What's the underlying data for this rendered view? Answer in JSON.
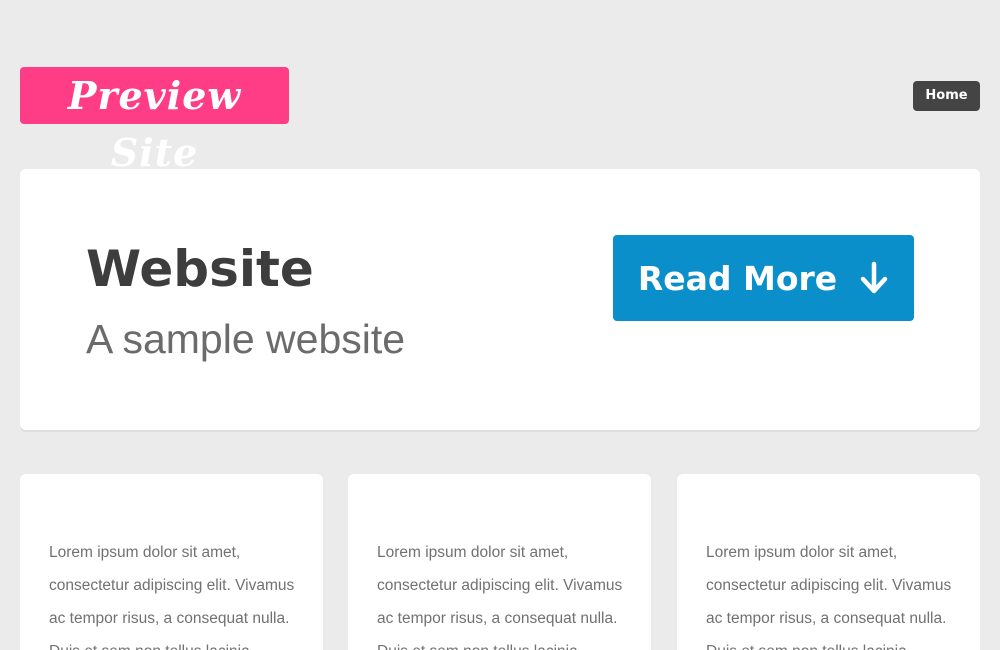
{
  "header": {
    "logo_text": "Preview Site",
    "nav": [
      {
        "label": "Home"
      }
    ]
  },
  "hero": {
    "title": "Website",
    "subtitle": "A sample website",
    "cta_label": "Read More",
    "cta_icon": "arrow-down-icon"
  },
  "cards": [
    {
      "text": "Lorem ipsum dolor sit amet, consectetur adipiscing elit. Vivamus ac tempor risus, a consequat nulla. Duis et sem non tellus lacinia"
    },
    {
      "text": "Lorem ipsum dolor sit amet, consectetur adipiscing elit. Vivamus ac tempor risus, a consequat nulla. Duis et sem non tellus lacinia"
    },
    {
      "text": "Lorem ipsum dolor sit amet, consectetur adipiscing elit. Vivamus ac tempor risus, a consequat nulla. Duis et sem non tellus lacinia"
    }
  ],
  "colors": {
    "background": "#ebebeb",
    "logo_bg": "#ff3d86",
    "nav_bg": "#444444",
    "cta_bg": "#0b8fcb",
    "title_text": "#3d3d3d",
    "body_text": "#717171"
  }
}
